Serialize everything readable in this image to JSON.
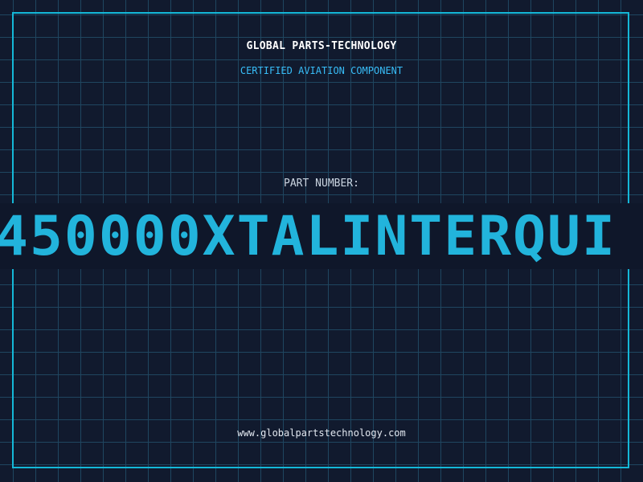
{
  "brand": {
    "name": "GLOBAL PARTS-TECHNOLOGY",
    "tagline": "CERTIFIED AVIATION COMPONENT"
  },
  "part": {
    "label": "PART NUMBER:",
    "number": "450000XTALINTERQUI"
  },
  "footer": {
    "website": "www.globalpartstechnology.com"
  },
  "colors": {
    "background": "#111a2e",
    "grid": "#1f4660",
    "accent": "#22b4dc",
    "frame": "#14b8d8"
  }
}
